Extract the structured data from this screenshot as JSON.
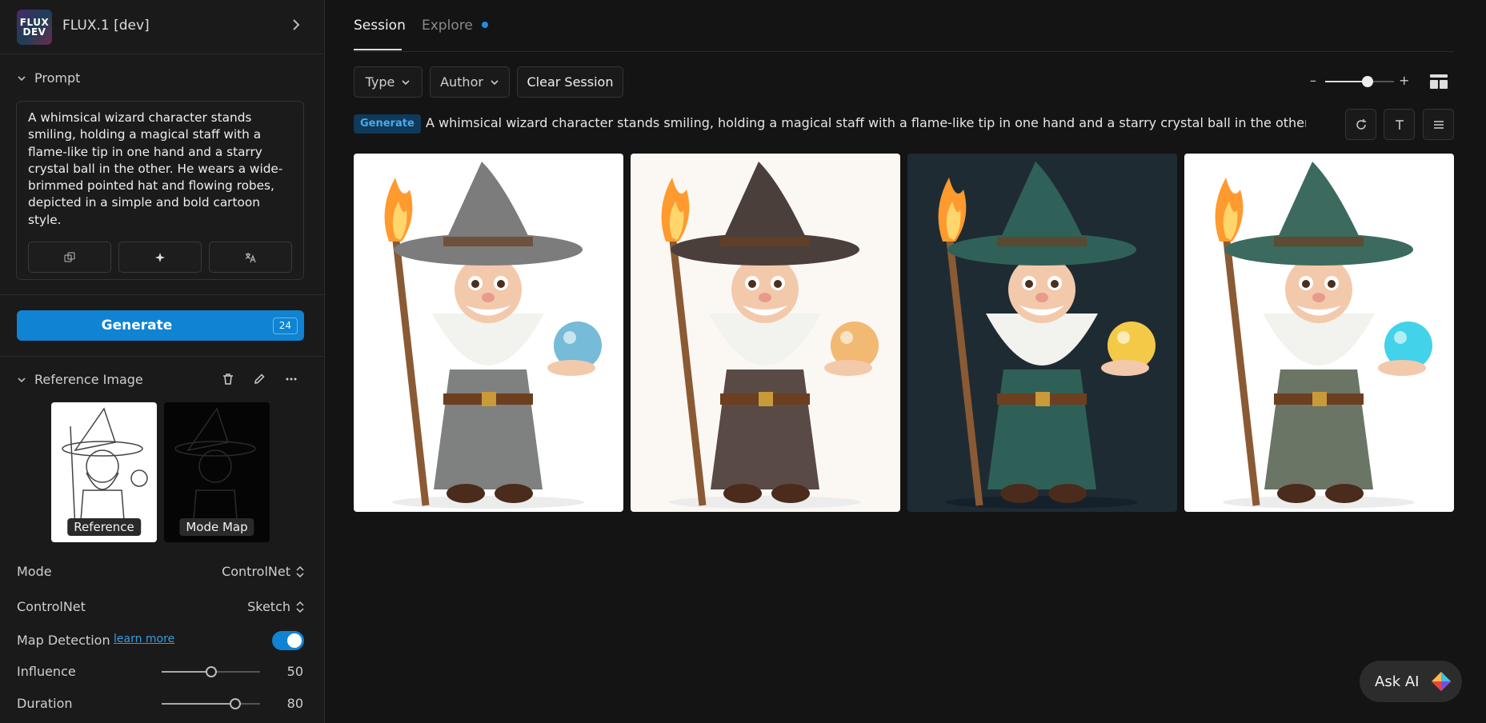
{
  "header": {
    "model_badge": "FLUX\nDEV",
    "model_name": "FLUX.1 [dev]"
  },
  "prompt_section": {
    "title": "Prompt",
    "text": "A whimsical wizard character stands smiling, holding a magical staff with a flame-like tip in one hand and a starry crystal ball in the other. He wears a wide-brimmed pointed hat and flowing robes, depicted in a simple and bold cartoon style.",
    "tools": [
      "copy-icon",
      "enhance-sparkle-icon",
      "translate-icon"
    ]
  },
  "generate": {
    "label": "Generate",
    "count": "24"
  },
  "reference": {
    "title": "Reference Image",
    "thumbs": [
      {
        "label": "Reference"
      },
      {
        "label": "Mode Map"
      }
    ]
  },
  "settings": {
    "mode": {
      "label": "Mode",
      "value": "ControlNet"
    },
    "controlnet": {
      "label": "ControlNet",
      "value": "Sketch"
    },
    "map_detection": {
      "label": "Map Detection",
      "link": "learn more",
      "enabled": true
    },
    "influence": {
      "label": "Influence",
      "value": "50",
      "fraction": 0.5
    },
    "duration": {
      "label": "Duration",
      "value": "80",
      "fraction": 0.75
    }
  },
  "tabs": [
    {
      "label": "Session",
      "active": true
    },
    {
      "label": "Explore",
      "dot": true
    }
  ],
  "filters": {
    "type": "Type",
    "author": "Author",
    "clear": "Clear Session"
  },
  "zoom": {
    "minus": "–",
    "plus": "+",
    "level": 0.62
  },
  "session_row": {
    "badge": "Generate",
    "prompt": "A whimsical wizard character stands smiling, holding a magical staff with a flame-like tip in one hand and a starry crystal ball in the other. He ..."
  },
  "images": [
    {
      "name": "gray-wizard",
      "bg": "#ffffff",
      "hat": "#7c7c7c",
      "robe": "#7f8080",
      "ball": "#6fb7d6"
    },
    {
      "name": "brown-wizard",
      "bg": "#fbf8f3",
      "hat": "#4a3f3b",
      "robe": "#5a4a45",
      "ball": "#f0b56a"
    },
    {
      "name": "green-wizard-dark",
      "bg": "#1f2b33",
      "hat": "#2f6158",
      "robe": "#2e6057",
      "ball": "#ffd34a"
    },
    {
      "name": "green-wizard-light",
      "bg": "#ffffff",
      "hat": "#3c6a5e",
      "robe": "#6a7565",
      "ball": "#38d0e8"
    }
  ],
  "ask_ai": {
    "label": "Ask AI"
  },
  "colors": {
    "accent": "#1083d2",
    "badge_text": "#49a9ec",
    "panel": "#1a1a1a",
    "main": "#141414"
  }
}
